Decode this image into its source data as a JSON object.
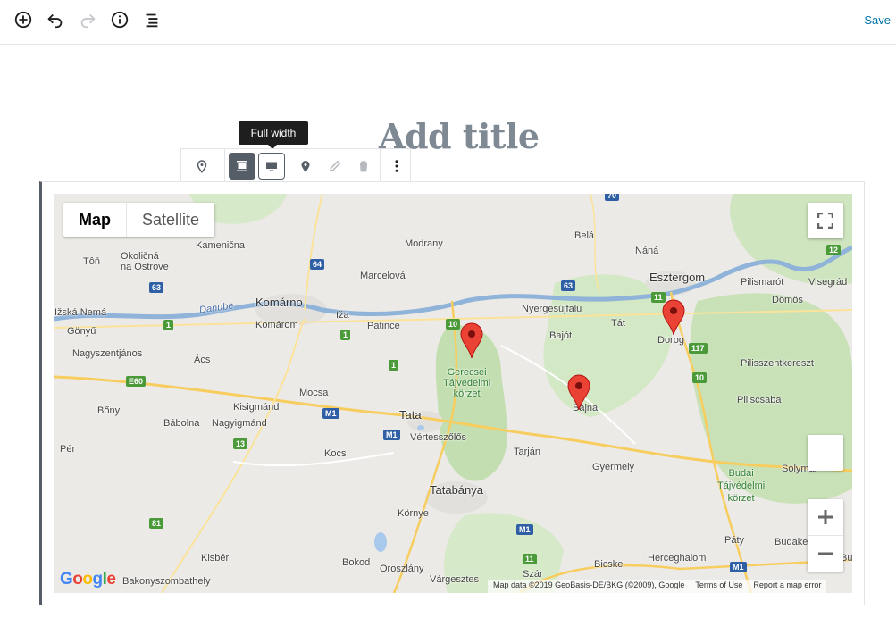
{
  "topbar": {
    "icons": [
      "add-block-icon",
      "undo-icon",
      "redo-icon",
      "info-icon",
      "outline-icon"
    ],
    "save_label": "Save"
  },
  "editor": {
    "title_placeholder": "Add title"
  },
  "tooltip": {
    "text": "Full width"
  },
  "block_toolbar": {
    "icons": [
      "map-block-icon",
      "align-wide-icon",
      "align-full-icon",
      "add-marker-icon",
      "edit-icon",
      "trash-icon",
      "more-options-icon"
    ]
  },
  "map": {
    "map_type": {
      "selected": "Map",
      "other": "Satellite"
    },
    "places": [
      {
        "t": "Kamenična"
      },
      {
        "t": "Modrany"
      },
      {
        "t": "Belá"
      },
      {
        "t": "Náná"
      },
      {
        "t": "Tôň"
      },
      {
        "t": "Okoličná\nna Ostrove"
      },
      {
        "t": "Marcelová"
      },
      {
        "t": "Esztergom"
      },
      {
        "t": "Pilismarót"
      },
      {
        "t": "Visegrád"
      },
      {
        "t": "Dömös"
      },
      {
        "t": "Komárno"
      },
      {
        "t": "Iža"
      },
      {
        "t": "Patince"
      },
      {
        "t": "Nyergesújfalu"
      },
      {
        "t": "Tát"
      },
      {
        "t": "Dorog"
      },
      {
        "t": "Komárom"
      },
      {
        "t": "Gönyű"
      },
      {
        "t": "Nagyszentjános"
      },
      {
        "t": "Ács"
      },
      {
        "t": "Bajót"
      },
      {
        "t": "Pilisszentkereszt"
      },
      {
        "t": "Mocsa"
      },
      {
        "t": "Bajna"
      },
      {
        "t": "Piliscsaba"
      },
      {
        "t": "Bőny"
      },
      {
        "t": "Kisigmánd"
      },
      {
        "t": "Tata"
      },
      {
        "t": "Bábolna"
      },
      {
        "t": "Nagyigmánd"
      },
      {
        "t": "Vértesszőlős"
      },
      {
        "t": "Tarján"
      },
      {
        "t": "Pér"
      },
      {
        "t": "Kocs"
      },
      {
        "t": "Gyermely"
      },
      {
        "t": "Solymár"
      },
      {
        "t": "Tatabánya"
      },
      {
        "t": "Környe"
      },
      {
        "t": "Páty"
      },
      {
        "t": "Budakeszi"
      },
      {
        "t": "Kisbér"
      },
      {
        "t": "Bokod"
      },
      {
        "t": "Oroszlány"
      },
      {
        "t": "Bicske"
      },
      {
        "t": "Herceghalom"
      },
      {
        "t": "Bakonyszombathely"
      },
      {
        "t": "Várgesztes"
      },
      {
        "t": "Szár"
      },
      {
        "t": "Bu"
      },
      {
        "t": "Ižská Nemá"
      }
    ],
    "parks": [
      "Gerecsei\nTájvédelmi\nkörzet",
      "Budai\nTájvédelmi\nkörzet"
    ],
    "river": "Danube",
    "road_shields": [
      "64",
      "63",
      "70",
      "12",
      "11",
      "63",
      "10",
      "117",
      "10",
      "1",
      "1",
      "E60",
      "M1",
      "M1",
      "13",
      "81",
      "M1",
      "M1",
      "1",
      "11"
    ],
    "footer": {
      "attribution": "Map data ©2019 GeoBasis-DE/BKG (©2009), Google",
      "terms": "Terms of Use",
      "report": "Report a map error"
    },
    "logo": "Google",
    "controls": [
      "fullscreen-icon",
      "street-view-pegman",
      "zoom-in-icon",
      "zoom-out-icon"
    ]
  }
}
